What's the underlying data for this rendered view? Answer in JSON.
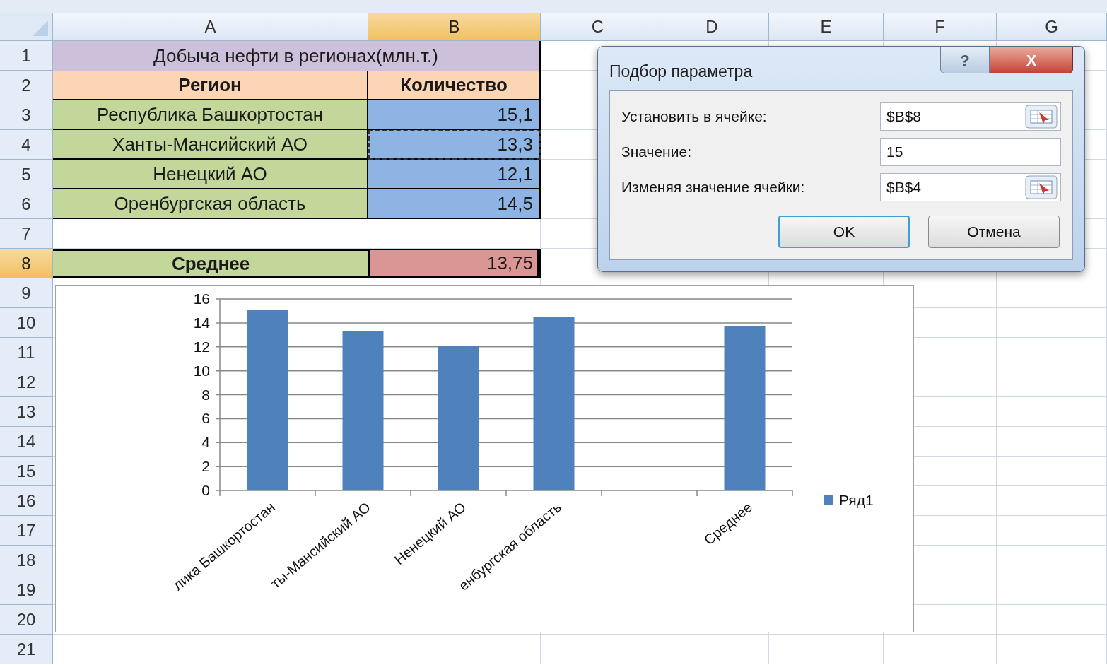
{
  "columns": [
    {
      "label": "A",
      "selected": false
    },
    {
      "label": "B",
      "selected": true
    },
    {
      "label": "C",
      "selected": false
    },
    {
      "label": "D",
      "selected": false
    },
    {
      "label": "E",
      "selected": false
    },
    {
      "label": "F",
      "selected": false
    },
    {
      "label": "G",
      "selected": false
    }
  ],
  "rows": [
    {
      "number": "1",
      "selected": false,
      "cells": [
        {
          "kind": "title",
          "text": "Добыча нефти в регионах(млн.т.)",
          "color": "#ccc0da",
          "marquee": false,
          "active": false
        }
      ]
    },
    {
      "number": "2",
      "selected": false,
      "cells": [
        {
          "kind": "header",
          "text": "Регион",
          "color": "#fcd5b4",
          "marquee": false,
          "active": false
        },
        {
          "kind": "header",
          "text": "Количество",
          "color": "#fcd5b4",
          "marquee": false,
          "active": false
        }
      ]
    },
    {
      "number": "3",
      "selected": false,
      "cells": [
        {
          "kind": "text",
          "text": "Республика Башкортостан",
          "color": "#c4d79b",
          "marquee": false,
          "active": false
        },
        {
          "kind": "number",
          "text": "15,1",
          "color": "#8db4e2",
          "marquee": false,
          "active": false
        }
      ]
    },
    {
      "number": "4",
      "selected": false,
      "cells": [
        {
          "kind": "text",
          "text": "Ханты-Мансийский АО",
          "color": "#c4d79b",
          "marquee": false,
          "active": false
        },
        {
          "kind": "number",
          "text": "13,3",
          "color": "#8db4e2",
          "marquee": true,
          "active": false
        }
      ]
    },
    {
      "number": "5",
      "selected": false,
      "cells": [
        {
          "kind": "text",
          "text": "Ненецкий АО",
          "color": "#c4d79b",
          "marquee": false,
          "active": false
        },
        {
          "kind": "number",
          "text": "12,1",
          "color": "#8db4e2",
          "marquee": false,
          "active": false
        }
      ]
    },
    {
      "number": "6",
      "selected": false,
      "cells": [
        {
          "kind": "text",
          "text": "Оренбургская область",
          "color": "#c4d79b",
          "marquee": false,
          "active": false
        },
        {
          "kind": "number",
          "text": "14,5",
          "color": "#8db4e2",
          "marquee": false,
          "active": false
        }
      ]
    },
    {
      "number": "7",
      "selected": false
    },
    {
      "number": "8",
      "selected": true,
      "cells": [
        {
          "kind": "total",
          "text": "Среднее",
          "color": "#c4d79b",
          "marquee": false,
          "active": false
        },
        {
          "kind": "number",
          "text": "13,75",
          "color": "#da9694",
          "marquee": false,
          "active": true
        }
      ]
    },
    {
      "number": "9",
      "selected": false
    },
    {
      "number": "10",
      "selected": false
    },
    {
      "number": "11",
      "selected": false
    },
    {
      "number": "12",
      "selected": false
    },
    {
      "number": "13",
      "selected": false
    },
    {
      "number": "14",
      "selected": false
    },
    {
      "number": "15",
      "selected": false
    },
    {
      "number": "16",
      "selected": false
    },
    {
      "number": "17",
      "selected": false
    },
    {
      "number": "18",
      "selected": false
    },
    {
      "number": "19",
      "selected": false
    },
    {
      "number": "20",
      "selected": false
    },
    {
      "number": "21",
      "selected": false
    }
  ],
  "chart": {
    "chart_data": {
      "type": "bar",
      "categories": [
        "лика Башкортостан",
        "ты-Мансийский АО",
        "Ненецкий АО",
        "енбургская область",
        null,
        "Среднее"
      ],
      "series": [
        {
          "name": "Ряд1",
          "color": "#4f81bd",
          "values": [
            15.1,
            13.3,
            12.1,
            14.5,
            null,
            13.75
          ]
        }
      ],
      "ylim": [
        0,
        16
      ],
      "grid": true,
      "yticks": [
        0,
        2,
        4,
        6,
        8,
        10,
        12,
        14,
        16
      ]
    }
  },
  "dialog": {
    "title": "Подбор параметра",
    "help": "?",
    "close": "X",
    "fields": [
      {
        "label": "Установить в ячейке:",
        "value": "$B$8",
        "kind": "ref"
      },
      {
        "label": "Значение:",
        "value": "15",
        "kind": "plain"
      },
      {
        "label": "Изменяя значение ячейки:",
        "value": "$B$4",
        "kind": "ref"
      }
    ],
    "buttons": [
      {
        "label": "OK",
        "default": true
      },
      {
        "label": "Отмена",
        "default": false
      }
    ]
  }
}
